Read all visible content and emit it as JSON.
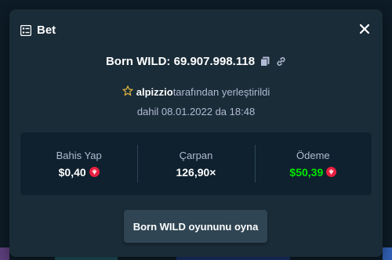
{
  "modal": {
    "title": "Bet",
    "title_icon": "bet-slip-icon",
    "close_icon": "close-icon"
  },
  "game": {
    "line": "Born WILD: 69.907.998.118",
    "copy_icon": "copy-icon",
    "link_icon": "link-icon"
  },
  "placed": {
    "user": "alpizzio",
    "suffix": "tarafından yerleştirildi",
    "date": "dahil 08.01.2022 da 18:48",
    "star_icon": "star-icon"
  },
  "stats": {
    "bet_label": "Bahis Yap",
    "bet_value": "$0,40",
    "multiplier_label": "Çarpan",
    "multiplier_value": "126,90×",
    "payout_label": "Ödeme",
    "payout_value": "$50,39",
    "currency_icon": "ruby-coin-icon"
  },
  "play_button": "Born WILD oyununu oyna",
  "colors": {
    "modal_bg": "#1a2c38",
    "panel_bg": "#0f212e",
    "button_bg": "#2f4553",
    "muted_text": "#b1bad3",
    "payout_green": "#00e701",
    "coin_red": "#e8203f"
  }
}
